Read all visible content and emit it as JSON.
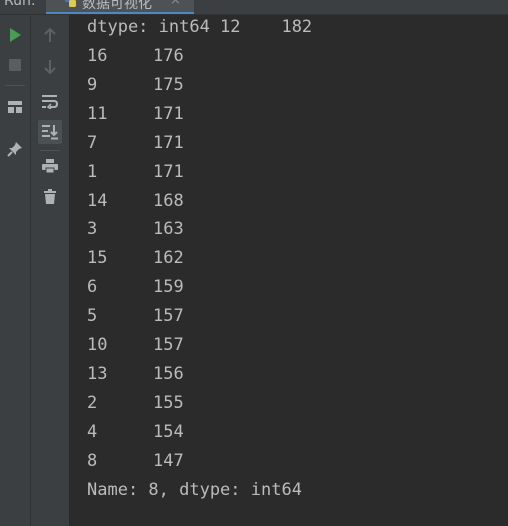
{
  "run_panel": {
    "label": "Run:",
    "tab": {
      "title": "数据可视化",
      "close": "×"
    }
  },
  "toolbar": {
    "run_icon": "play-icon",
    "stop_icon": "stop-icon",
    "layout_icon": "layout-icon",
    "pin_icon": "pin-icon",
    "up_icon": "arrow-up-icon",
    "down_icon": "arrow-down-icon",
    "wrap_icon": "soft-wrap-icon",
    "scroll_end_icon": "scroll-to-end-icon",
    "print_icon": "print-icon",
    "trash_icon": "trash-icon"
  },
  "console": {
    "header_line": "dtype: int64 12    182",
    "rows": [
      {
        "index": "16",
        "value": "176"
      },
      {
        "index": "9",
        "value": "175"
      },
      {
        "index": "11",
        "value": "171"
      },
      {
        "index": "7",
        "value": "171"
      },
      {
        "index": "1",
        "value": "171"
      },
      {
        "index": "14",
        "value": "168"
      },
      {
        "index": "3",
        "value": "163"
      },
      {
        "index": "15",
        "value": "162"
      },
      {
        "index": "6",
        "value": "159"
      },
      {
        "index": "5",
        "value": "157"
      },
      {
        "index": "10",
        "value": "157"
      },
      {
        "index": "13",
        "value": "156"
      },
      {
        "index": "2",
        "value": "155"
      },
      {
        "index": "4",
        "value": "154"
      },
      {
        "index": "8",
        "value": "147"
      }
    ],
    "footer_line": "Name: 8, dtype: int64"
  },
  "colors": {
    "background": "#2b2b2b",
    "toolbar": "#3c3f41",
    "text": "#bbbbbb",
    "run_green": "#499c54",
    "tab_accent": "#4a88c7"
  }
}
